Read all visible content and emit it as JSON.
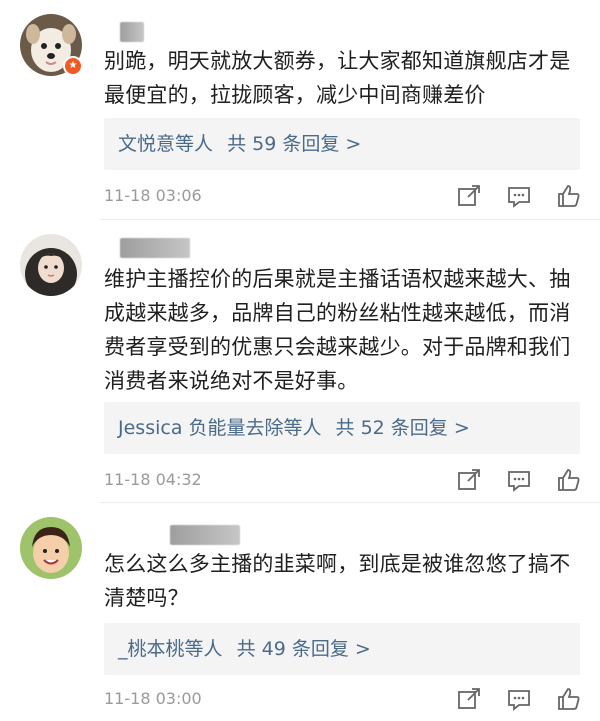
{
  "comments": [
    {
      "text": "别跪，明天就放大额券，让大家都知道旗舰店才是最便宜的，拉拢顾客，减少中间商赚差价",
      "reply_who": "文悦意等人",
      "reply_count": "共 59 条回复 >",
      "time": "11-18 03:06",
      "badge_icon": "verified-badge-icon"
    },
    {
      "text": "维护主播控价的后果就是主播话语权越来越大、抽成越来越多，品牌自己的粉丝粘性越来越低，而消费者享受到的优惠只会越来越少。对于品牌和我们消费者来说绝对不是好事。",
      "reply_who": "Jessica 负能量去除等人",
      "reply_count": "共 52 条回复 >",
      "time": "11-18 04:32"
    },
    {
      "text": "怎么这么多主播的韭菜啊，到底是被谁忽悠了搞不清楚吗？",
      "reply_who": "_桃本桃等人",
      "reply_count": "共 49 条回复 >",
      "time": "11-18 03:00"
    }
  ],
  "icons": {
    "share": "share-icon",
    "comment": "comment-icon",
    "like": "thumbs-up-icon"
  },
  "colors": {
    "link": "#4a6a8a",
    "time": "#9a9a9a",
    "reply_bg": "#f4f4f4",
    "badge": "#f15a24"
  }
}
